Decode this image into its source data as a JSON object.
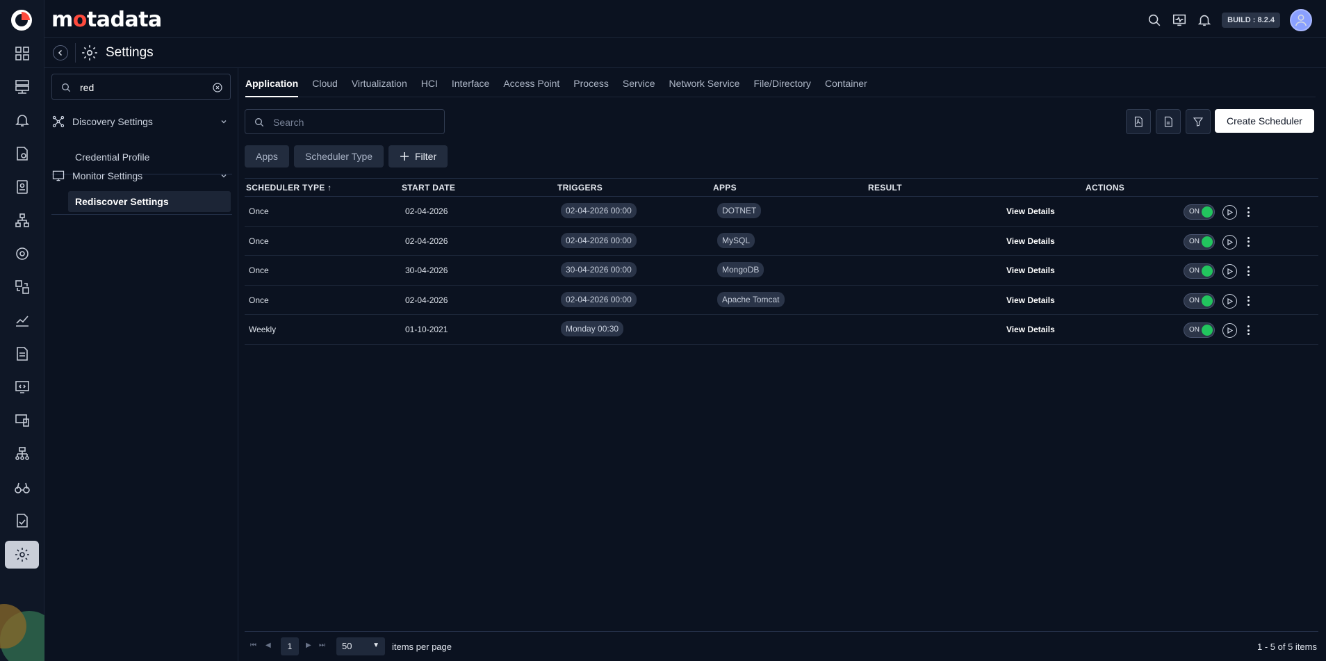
{
  "brand": {
    "name_pre": "m",
    "name_o": "o",
    "name_post": "tadata"
  },
  "header": {
    "build": "BUILD : 8.2.4"
  },
  "page": {
    "title": "Settings"
  },
  "leftpanel": {
    "search_value": "red",
    "sections": [
      {
        "label": "Discovery Settings",
        "items": [
          "Credential Profile"
        ]
      },
      {
        "label": "Monitor Settings",
        "items": [
          "Rediscover Settings"
        ]
      }
    ]
  },
  "tabs": [
    "Application",
    "Cloud",
    "Virtualization",
    "HCI",
    "Interface",
    "Access Point",
    "Process",
    "Service",
    "Network Service",
    "File/Directory",
    "Container"
  ],
  "toolbar": {
    "search_placeholder": "Search",
    "create_label": "Create Scheduler",
    "chips": [
      "Apps",
      "Scheduler Type",
      "Filter"
    ]
  },
  "table": {
    "headers": [
      "SCHEDULER TYPE ↑",
      "START DATE",
      "TRIGGERS",
      "APPS",
      "RESULT",
      "ACTIONS"
    ],
    "rows": [
      {
        "type": "Once",
        "start": "02-04-2026",
        "trigger": "02-04-2026 00:00",
        "app": "DOTNET",
        "result": "View Details",
        "toggle": "ON"
      },
      {
        "type": "Once",
        "start": "02-04-2026",
        "trigger": "02-04-2026 00:00",
        "app": "MySQL",
        "result": "View Details",
        "toggle": "ON"
      },
      {
        "type": "Once",
        "start": "30-04-2026",
        "trigger": "30-04-2026 00:00",
        "app": "MongoDB",
        "result": "View Details",
        "toggle": "ON"
      },
      {
        "type": "Once",
        "start": "02-04-2026",
        "trigger": "02-04-2026 00:00",
        "app": "Apache Tomcat",
        "result": "View Details",
        "toggle": "ON"
      },
      {
        "type": "Weekly",
        "start": "01-10-2021",
        "trigger": "Monday 00:30",
        "app": "",
        "result": "View Details",
        "toggle": "ON"
      }
    ]
  },
  "pagination": {
    "current_page": "1",
    "page_size": "50",
    "label": "items per page",
    "count": "1 - 5 of 5 items"
  },
  "colors": {
    "accent_on": "#22c55e",
    "logo_red": "#ff4a3d",
    "bg": "#0b1220"
  },
  "rail_icons": [
    "dashboard-icon",
    "server-icon",
    "bell-icon",
    "policy-icon",
    "inventory-icon",
    "topology-icon",
    "discovery-icon",
    "flow-icon",
    "metric-icon",
    "report-icon",
    "code-monitor-icon",
    "devices-icon",
    "network-icon",
    "binoculars-icon",
    "audit-icon",
    "settings-icon"
  ]
}
